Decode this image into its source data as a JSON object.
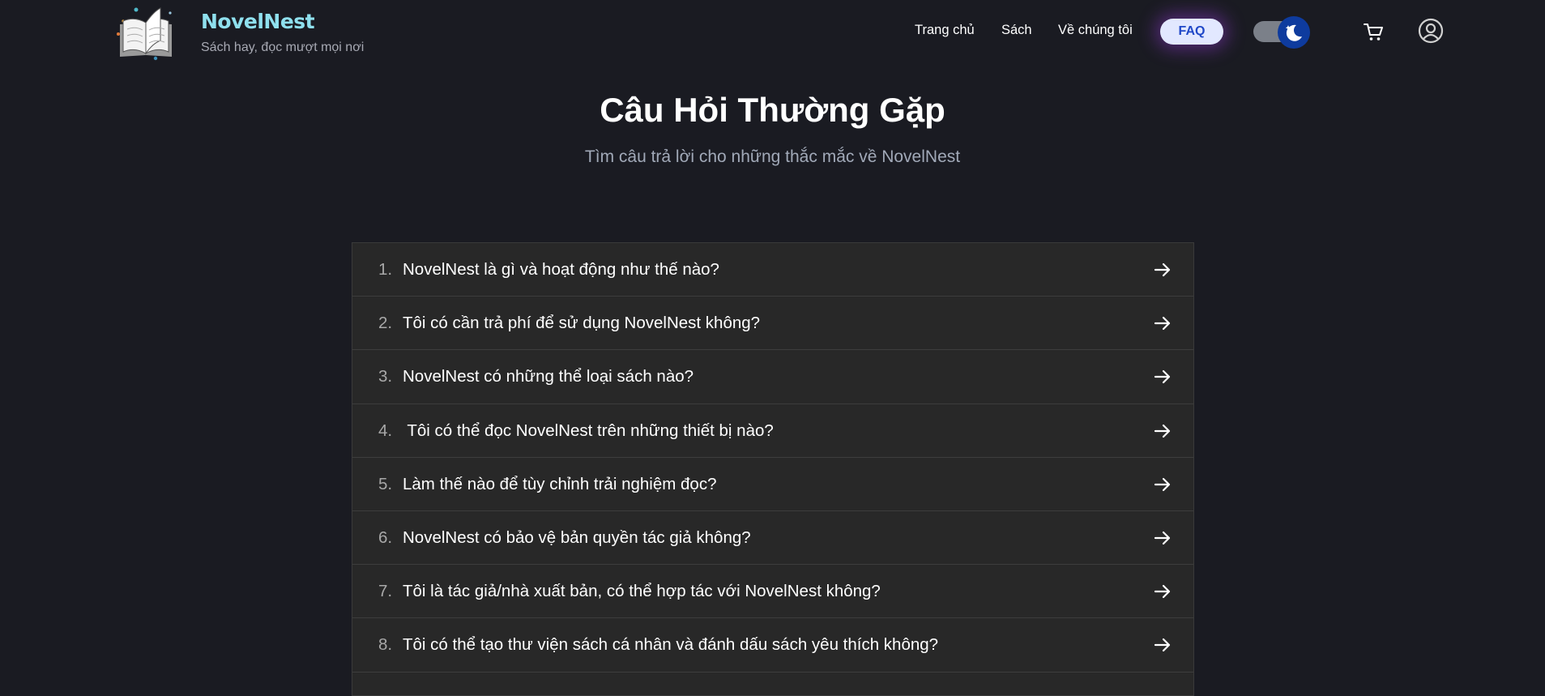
{
  "brand": {
    "name": "NovelNest",
    "tagline": "Sách hay, đọc mượt mọi nơi",
    "logo_icon": "open-book-icon"
  },
  "nav": {
    "home": "Trang chủ",
    "books": "Sách",
    "about": "Về chúng tôi",
    "faq": "FAQ"
  },
  "header_icons": {
    "theme_toggle": "moon-icon",
    "cart": "cart-icon",
    "account": "user-circle-icon"
  },
  "colors": {
    "background": "#1a1b22",
    "brand": "#8fe0ee",
    "faq_active_bg": "#e2e8ff",
    "faq_active_text": "#2048c8",
    "toggle_knob": "#0e3b9e",
    "list_bg": "#282828"
  },
  "hero": {
    "title": "Câu Hỏi Thường Gặp",
    "subtitle": "Tìm câu trả lời cho những thắc mắc về NovelNest"
  },
  "faq": {
    "items": [
      {
        "num": "1.",
        "question": "NovelNest là gì và hoạt động như thế nào?"
      },
      {
        "num": "2.",
        "question": "Tôi có cần trả phí để sử dụng NovelNest không?"
      },
      {
        "num": "3.",
        "question": "NovelNest có những thể loại sách nào?"
      },
      {
        "num": "4.",
        "question": " Tôi có thể đọc NovelNest trên những thiết bị nào?"
      },
      {
        "num": "5.",
        "question": "Làm thế nào để tùy chỉnh trải nghiệm đọc?"
      },
      {
        "num": "6.",
        "question": "NovelNest có bảo vệ bản quyền tác giả không?"
      },
      {
        "num": "7.",
        "question": "Tôi là tác giả/nhà xuất bản, có thể hợp tác với NovelNest không?"
      },
      {
        "num": "8.",
        "question": "Tôi có thể tạo thư viện sách cá nhân và đánh dấu sách yêu thích không?"
      }
    ],
    "arrow_icon": "arrow-right-icon"
  }
}
